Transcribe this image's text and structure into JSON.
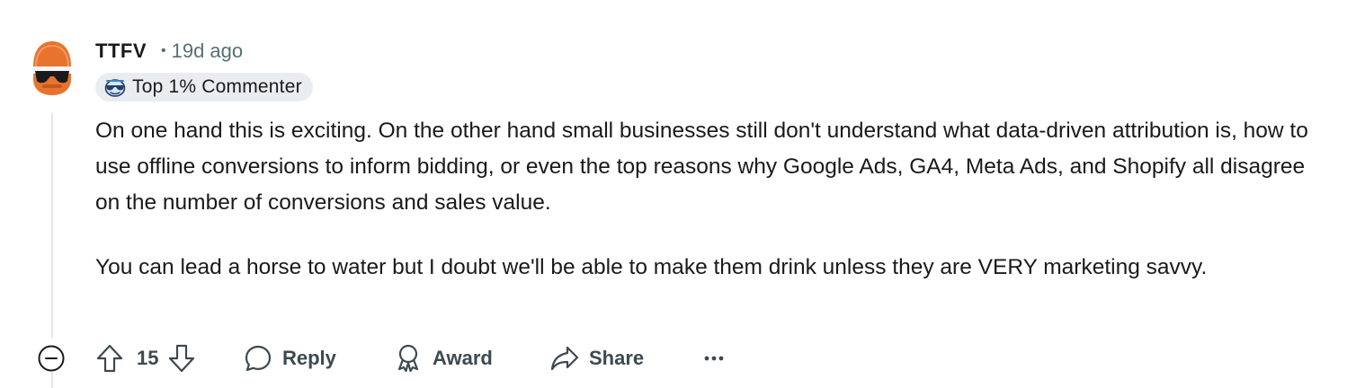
{
  "comment": {
    "author": "TTFV",
    "separator": "•",
    "timestamp": "19d ago",
    "flair": {
      "icon": "sunglasses-emoji-icon",
      "label": "Top 1% Commenter"
    },
    "body": {
      "paragraphs": [
        "On one hand this is exciting. On the other hand small businesses still don't understand what data-driven attribution is, how to use offline conversions to inform bidding, or even the top reasons why Google Ads, GA4, Meta Ads, and Shopify all disagree on the number of conversions and sales value.",
        "You can lead a horse to water but I doubt we'll be able to make them drink unless they are VERY marketing savvy."
      ]
    },
    "avatar": {
      "icon": "snoo-avatar-orange-helmet",
      "colors": {
        "helmet": "#e8732f",
        "sunglasses": "#1a1a1b",
        "face": "#f5f5f5"
      }
    }
  },
  "actions": {
    "collapse_icon": "minus-circle-icon",
    "upvote_icon": "arrow-up-icon",
    "vote_count": "15",
    "downvote_icon": "arrow-down-icon",
    "reply_label": "Reply",
    "reply_icon": "speech-bubble-icon",
    "award_label": "Award",
    "award_icon": "award-ribbon-icon",
    "share_label": "Share",
    "share_icon": "share-arrow-icon",
    "more_icon": "ellipsis-icon"
  },
  "colors": {
    "text_primary": "#1a1a1b",
    "text_secondary": "#576f76",
    "action_text": "#3c4a50",
    "flair_bg": "#eaedef",
    "thread_line": "#e5e8ea"
  }
}
